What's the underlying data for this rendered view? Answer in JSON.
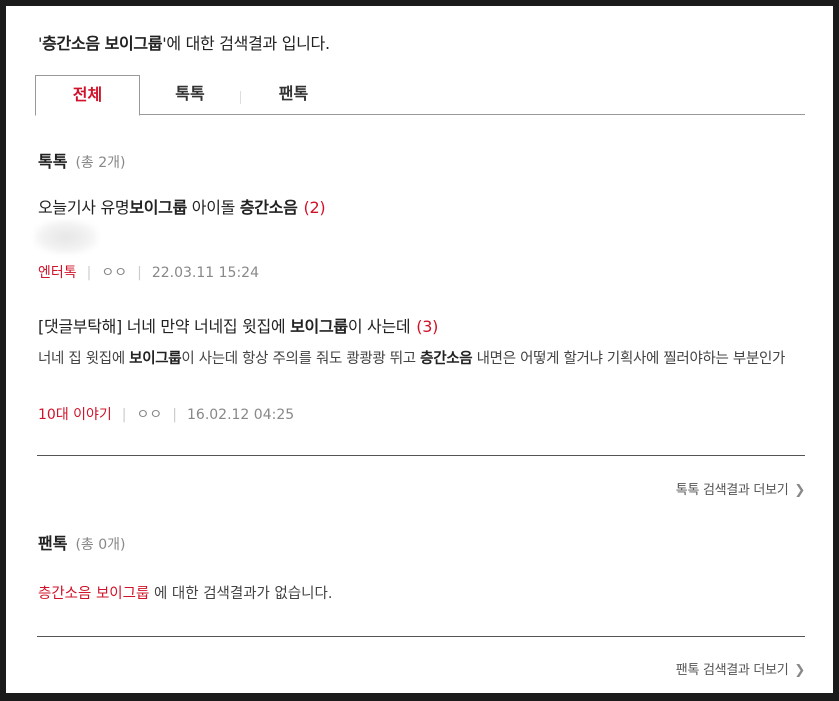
{
  "search": {
    "keyword_part1": "층간소음",
    "keyword_part2": "보이그룹",
    "heading_suffix": "에 대한 검색결과 입니다."
  },
  "tabs": [
    {
      "label": "전체",
      "active": true
    },
    {
      "label": "톡톡",
      "active": false
    },
    {
      "label": "팬톡",
      "active": false
    }
  ],
  "toktok": {
    "title": "톡톡",
    "count": "(총 2개)",
    "posts": [
      {
        "title_a": "오늘기사 유명",
        "title_b": "보이그룹",
        "title_c": " 아이돌 ",
        "title_d": "층간소음",
        "comments": "(2)",
        "category": "엔터톡",
        "author": "ㅇㅇ",
        "date": "22.03.11 15:24"
      },
      {
        "title_a": "[댓글부탁해] 너네 만약 너네집 윗집에 ",
        "title_b": "보이그룹",
        "title_c": "이 사는데",
        "comments": "(3)",
        "snippet_a": "너네 집 윗집에 ",
        "snippet_b": "보이그룹",
        "snippet_c": "이 사는데 항상 주의를 줘도 쾅쾅쾅 뛰고 ",
        "snippet_d": "층간소음",
        "snippet_e": " 내면은 어떻게 할거냐 기획사에 찔러야하는 부분인가",
        "category": "10대 이야기",
        "author": "ㅇㅇ",
        "date": "16.02.12 04:25"
      }
    ],
    "more": "톡톡 검색결과 더보기"
  },
  "fantok": {
    "title": "팬톡",
    "count": "(총 0개)",
    "empty_keyword": "층간소음 보이그룹",
    "empty_suffix": " 에 대한 검색결과가 없습니다.",
    "more": "팬톡 검색결과 더보기"
  },
  "colors": {
    "accent": "#d0132a",
    "text": "#222222",
    "muted": "#888888"
  }
}
